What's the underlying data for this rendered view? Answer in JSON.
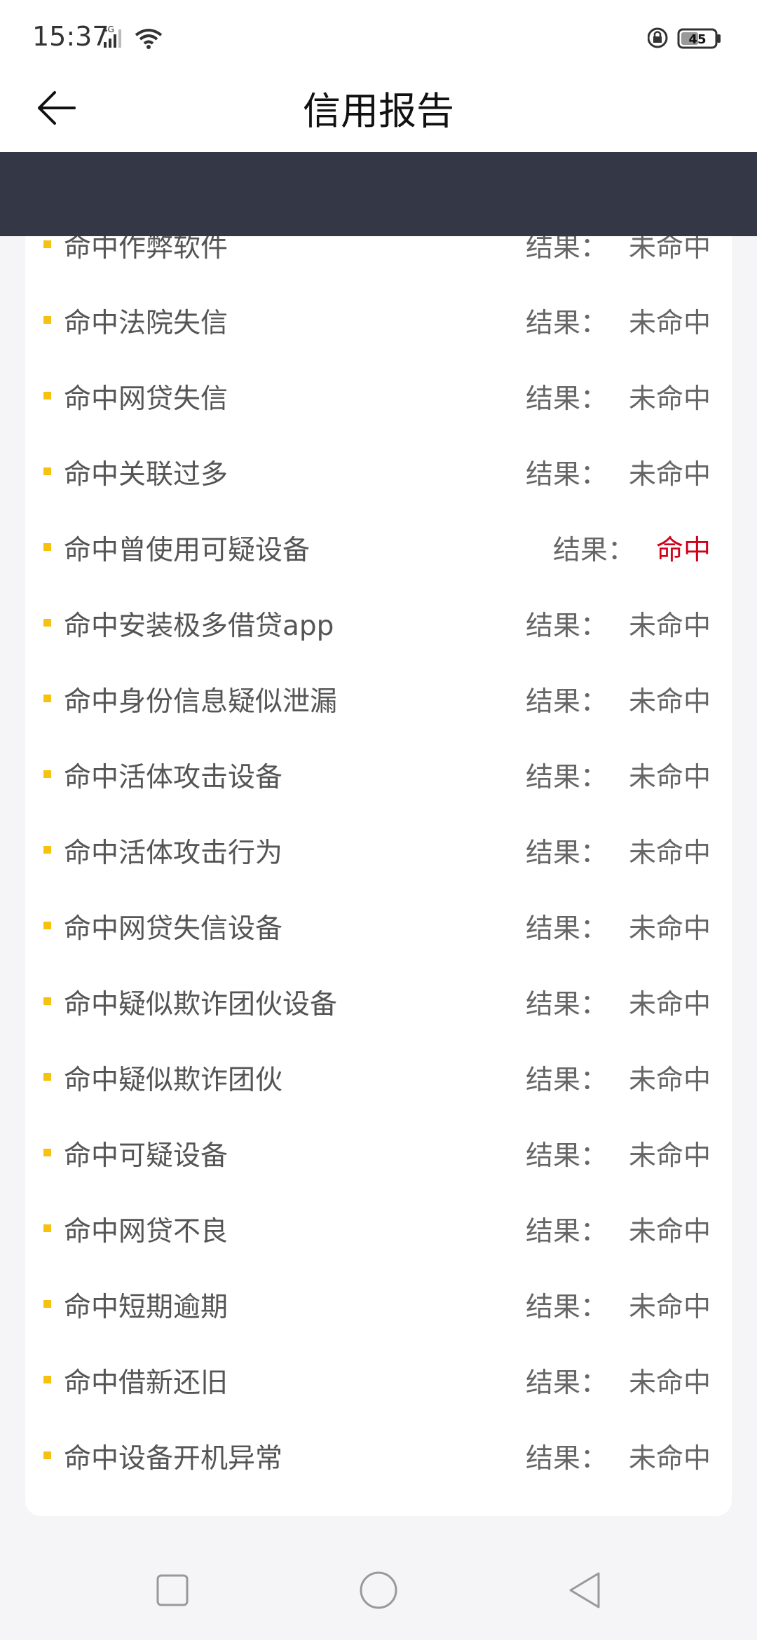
{
  "status": {
    "time": "15:37",
    "network": "4G",
    "battery": "45"
  },
  "header": {
    "title": "信用报告"
  },
  "result_label": "结果：",
  "items": [
    {
      "label": "命中作弊软件",
      "result": "未命中"
    },
    {
      "label": "命中法院失信",
      "result": "未命中"
    },
    {
      "label": "命中网贷失信",
      "result": "未命中"
    },
    {
      "label": "命中关联过多",
      "result": "未命中"
    },
    {
      "label": "命中曾使用可疑设备",
      "result": "命中",
      "hit": true
    },
    {
      "label": "命中安装极多借贷app",
      "result": "未命中"
    },
    {
      "label": "命中身份信息疑似泄漏",
      "result": "未命中"
    },
    {
      "label": "命中活体攻击设备",
      "result": "未命中"
    },
    {
      "label": "命中活体攻击行为",
      "result": "未命中"
    },
    {
      "label": "命中网贷失信设备",
      "result": "未命中"
    },
    {
      "label": "命中疑似欺诈团伙设备",
      "result": "未命中"
    },
    {
      "label": "命中疑似欺诈团伙",
      "result": "未命中"
    },
    {
      "label": "命中可疑设备",
      "result": "未命中"
    },
    {
      "label": "命中网贷不良",
      "result": "未命中"
    },
    {
      "label": "命中短期逾期",
      "result": "未命中"
    },
    {
      "label": "命中借新还旧",
      "result": "未命中"
    },
    {
      "label": "命中设备开机异常",
      "result": "未命中"
    }
  ],
  "colors": {
    "accent_bullet": "#f6c20f",
    "hit_red": "#d0021b",
    "dark_band": "#343846"
  }
}
